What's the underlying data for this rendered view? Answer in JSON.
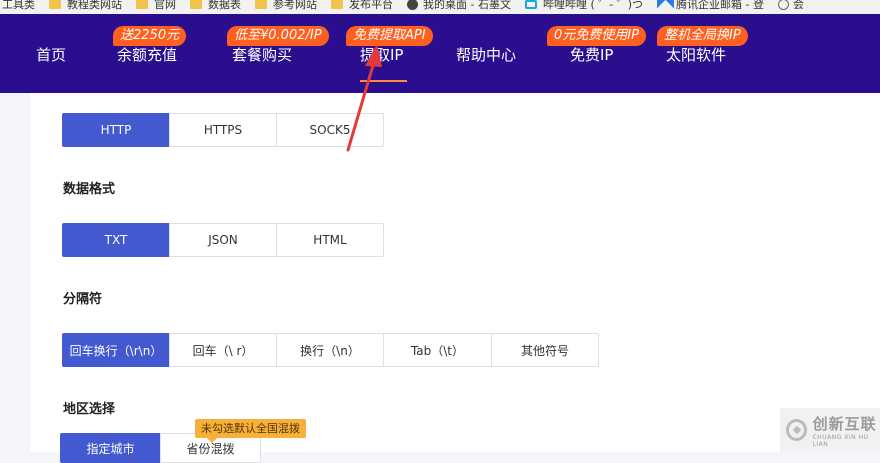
{
  "bookmarks": [
    {
      "label": "工具类",
      "icon": "none"
    },
    {
      "label": "教程类网站",
      "icon": "folder-icon"
    },
    {
      "label": "官网",
      "icon": "folder-icon"
    },
    {
      "label": "数据表",
      "icon": "folder-icon"
    },
    {
      "label": "参考网站",
      "icon": "folder-icon"
    },
    {
      "label": "发布平台",
      "icon": "folder-icon"
    },
    {
      "label": "我的桌面 - 石墨文",
      "icon": "shimo-icon"
    },
    {
      "label": "哔哩哔哩 ( ゜- ゜)つ",
      "icon": "bilibili-icon"
    },
    {
      "label": "腾讯企业邮箱 - 登",
      "icon": "wechat-work-icon"
    },
    {
      "label": "会",
      "icon": "globe-icon"
    }
  ],
  "nav": {
    "items": [
      {
        "label": "首页",
        "badge": ""
      },
      {
        "label": "余额充值",
        "badge": "送2250元"
      },
      {
        "label": "套餐购买",
        "badge": "低至¥0.002/IP"
      },
      {
        "label": "提取IP",
        "badge": "免费提取API"
      },
      {
        "label": "帮助中心",
        "badge": ""
      },
      {
        "label": "免费IP",
        "badge": "0元免费使用IP"
      },
      {
        "label": "太阳软件",
        "badge": "整机全局换IP"
      }
    ],
    "active": "提取IP"
  },
  "protocol": {
    "options": [
      "HTTP",
      "HTTPS",
      "SOCK5"
    ],
    "selected": "HTTP"
  },
  "data_format": {
    "label": "数据格式",
    "options": [
      "TXT",
      "JSON",
      "HTML"
    ],
    "selected": "TXT"
  },
  "separator": {
    "label": "分隔符",
    "options": [
      "回车换行（\\r\\n）",
      "回车（\\ r）",
      "换行（\\n）",
      "Tab（\\t）",
      "其他符号"
    ],
    "selected": "回车换行（\\r\\n）"
  },
  "region": {
    "label": "地区选择",
    "options": [
      "指定城市",
      "省份混拨"
    ],
    "selected": "指定城市",
    "tooltip": "未勾选默认全国混拨"
  },
  "watermark": {
    "main": "创新互联",
    "sub": "CHUANG XIN HU LIAN"
  },
  "colors": {
    "nav_bg": "#2a0e8e",
    "badge": "#ff5f1f",
    "active_option": "#4359cf",
    "arrow": "#e23a3a",
    "tooltip": "#f5b13a"
  }
}
